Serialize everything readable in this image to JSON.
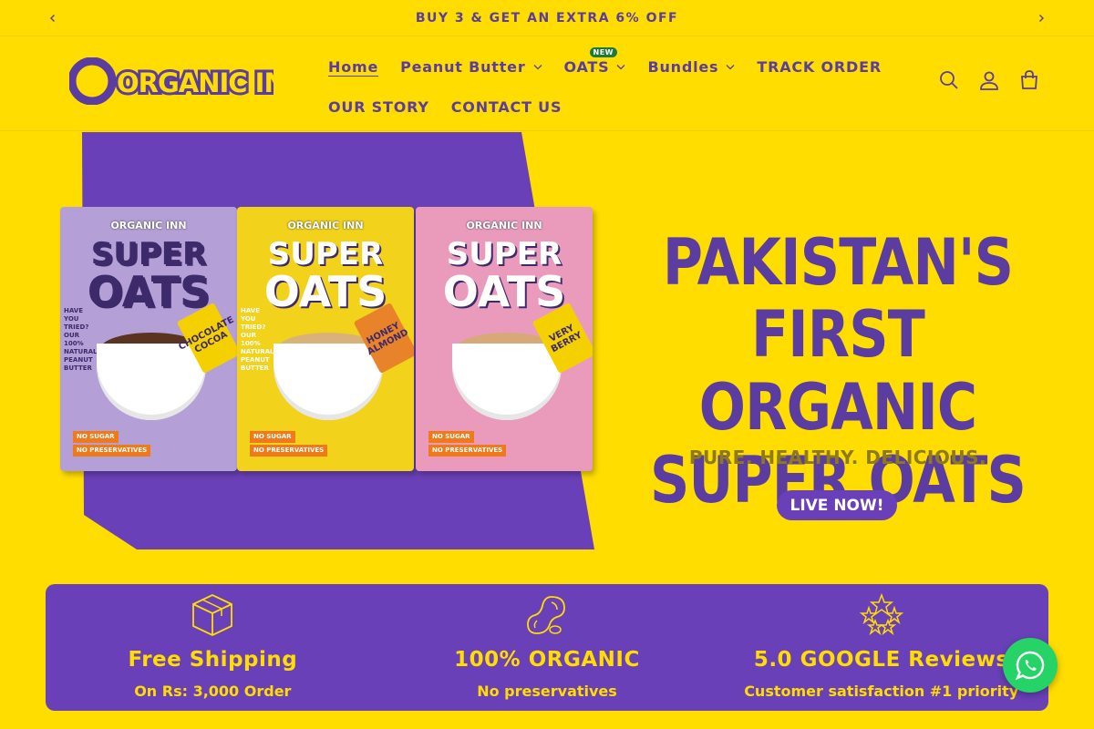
{
  "announcement": {
    "text": "BUY 3 & GET AN EXTRA 6% OFF",
    "prev_icon": "chevron-left-icon",
    "next_icon": "chevron-right-icon"
  },
  "header": {
    "logo_text": "ORGANIC INN",
    "nav": {
      "row1": [
        {
          "label": "Home",
          "active": true
        },
        {
          "label": "Peanut Butter",
          "dropdown": true
        },
        {
          "label": "OATS",
          "dropdown": true,
          "badge": "NEW"
        },
        {
          "label": "Bundles",
          "dropdown": true
        },
        {
          "label": "TRACK ORDER"
        }
      ],
      "row2": [
        {
          "label": "OUR STORY"
        },
        {
          "label": "CONTACT US"
        }
      ]
    },
    "icons": [
      "search-icon",
      "account-icon",
      "cart-icon"
    ]
  },
  "hero": {
    "headline": [
      "PAKISTAN'S",
      "FIRST ORGANIC",
      "SUPER OATS"
    ],
    "tagline": "PURE. HEALTHY. DELICIOUS.",
    "cta": "LIVE NOW!",
    "products": [
      {
        "brand": "ORGANIC INN",
        "line1": "SUPER",
        "line2": "OATS",
        "flavor": "CHOCOLATE COCOA",
        "box_color": "#b49fd6",
        "text_color": "#3d2a6a",
        "fill_color": "#5a3420",
        "flavor_bg": "#f5d000"
      },
      {
        "brand": "ORGANIC INN",
        "line1": "SUPER",
        "line2": "OATS",
        "flavor": "HONEY ALMOND",
        "box_color": "#f2d21a",
        "text_color": "#ffffff",
        "fill_color": "#d9b27a",
        "flavor_bg": "#e8832a"
      },
      {
        "brand": "ORGANIC INN",
        "line1": "SUPER",
        "line2": "OATS",
        "flavor": "VERY BERRY",
        "box_color": "#ea9bbb",
        "text_color": "#ffffff",
        "fill_color": "#d8a878",
        "flavor_bg": "#f5d000"
      }
    ],
    "box_tags": [
      "NO SUGAR",
      "NO PRESERVATIVES"
    ],
    "box_side": "HAVE YOU TRIED? OUR 100% NATURAL PEANUT BUTTER"
  },
  "features": [
    {
      "icon": "box-icon",
      "title": "Free Shipping",
      "subtitle": "On Rs: 3,000 Order"
    },
    {
      "icon": "peanut-icon",
      "title": "100% ORGANIC",
      "subtitle": "No preservatives"
    },
    {
      "icon": "stars-icon",
      "title": "5.0 GOOGLE Reviews",
      "subtitle": "Customer satisfaction #1 priority"
    }
  ],
  "whatsapp": {
    "icon": "whatsapp-icon"
  },
  "colors": {
    "yellow": "#FFDD00",
    "purple": "#6a40b8",
    "dark_purple": "#5b3ca0"
  }
}
